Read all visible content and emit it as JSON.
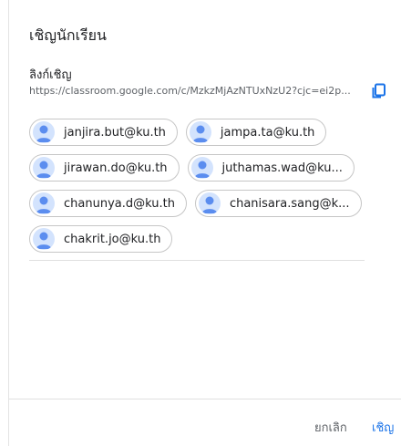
{
  "dialog": {
    "title": "เชิญนักเรียน",
    "link_label": "ลิงก์เชิญ",
    "link_url": "https://classroom.google.com/c/MzkzMjAzNTUxNzU2?cjc=ei2p...",
    "copy_icon": "copy-icon"
  },
  "invitees": [
    [
      "janjira.but@ku.th",
      "jampa.ta@ku.th"
    ],
    [
      "jirawan.do@ku.th",
      "juthamas.wad@ku..."
    ],
    [
      "chanunya.d@ku.th",
      "chanisara.sang@k..."
    ],
    [
      "chakrit.jo@ku.th"
    ]
  ],
  "footer": {
    "cancel_label": "ยกเลิก",
    "invite_label": "เชิญ"
  },
  "colors": {
    "accent": "#1a73e8",
    "avatar_bg": "#d3e3fd",
    "avatar_fg": "#5b8def"
  }
}
